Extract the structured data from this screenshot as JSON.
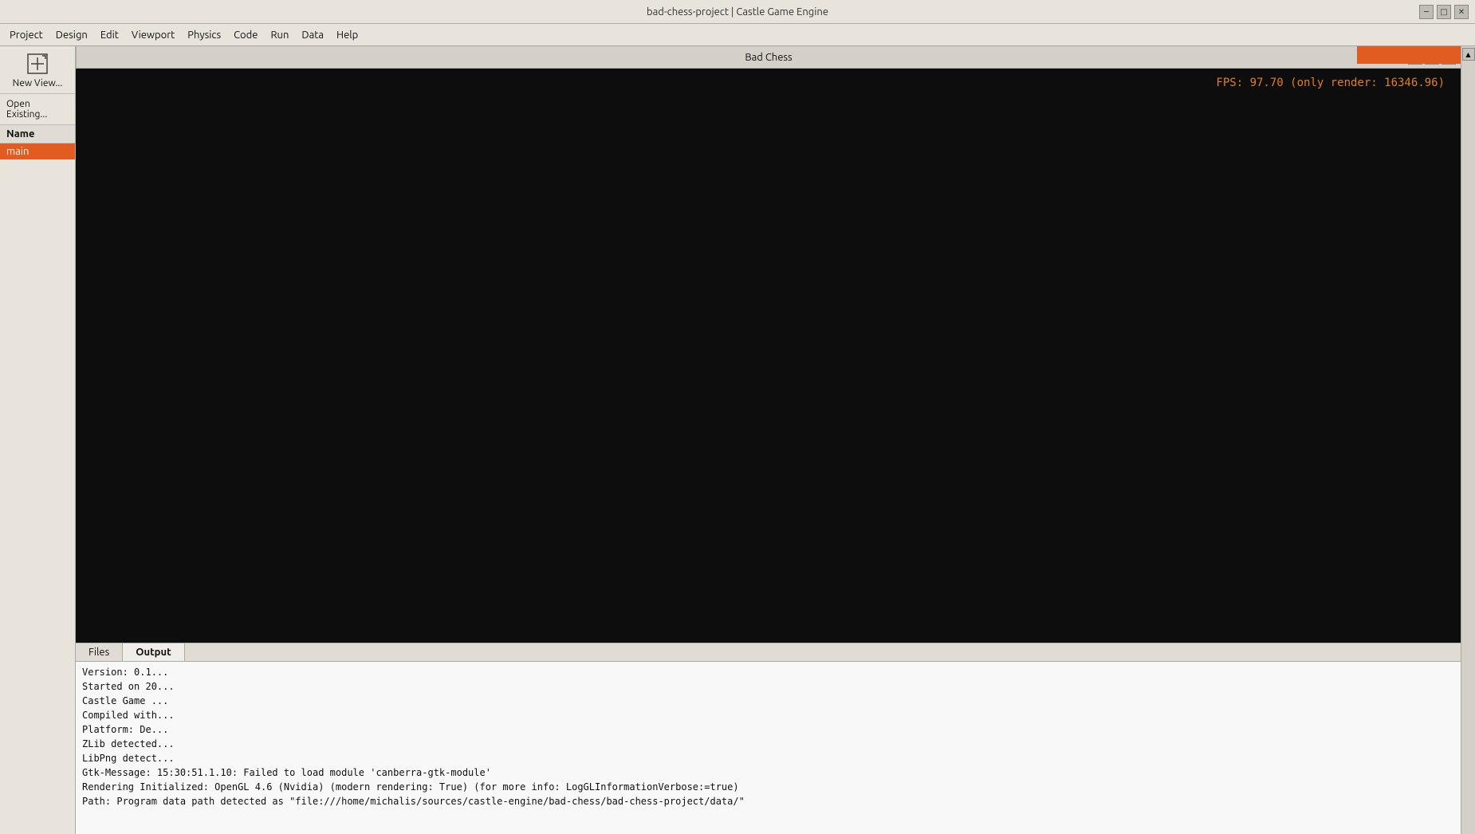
{
  "window": {
    "title": "bad-chess-project | Castle Game Engine"
  },
  "menu": {
    "items": [
      "Project",
      "Design",
      "Edit",
      "Viewport",
      "Physics",
      "Code",
      "Run",
      "Data",
      "Help"
    ]
  },
  "left_panel": {
    "new_view_label": "New View...",
    "open_existing_label": "Open Existing...",
    "name_header": "Name",
    "scenes": [
      {
        "name": "main",
        "active": true
      }
    ]
  },
  "game_window": {
    "title": "Bad Chess",
    "fps_text": "FPS: 97.70 (only render: 16346.96)"
  },
  "bottom": {
    "tabs": [
      {
        "label": "Files",
        "active": false
      },
      {
        "label": "Output",
        "active": true
      }
    ],
    "output_lines": [
      "Version: 0.1...",
      "Started on 20...",
      "Castle Game ...",
      "Compiled with...",
      "Platform: De...",
      "ZLib detected...",
      "LibPng detect...",
      "Gtk-Message: 15:30:51.1.10: Failed to load module 'canberra-gtk-module'",
      "Rendering Initialized: OpenGL 4.6 (Nvidia) (modern rendering: True) (for more info: LogGLInformationVerbose:=true)",
      "Path: Program data path detected as \"file:///home/michalis/sources/castle-engine/bad-chess/bad-chess-project/data/\""
    ]
  },
  "icons": {
    "new_view": "⊞",
    "minimize": "─",
    "restore": "□",
    "close": "✕",
    "scroll_up": "▲",
    "game_minimize": "─",
    "game_restore": "□",
    "game_close": "✕"
  }
}
